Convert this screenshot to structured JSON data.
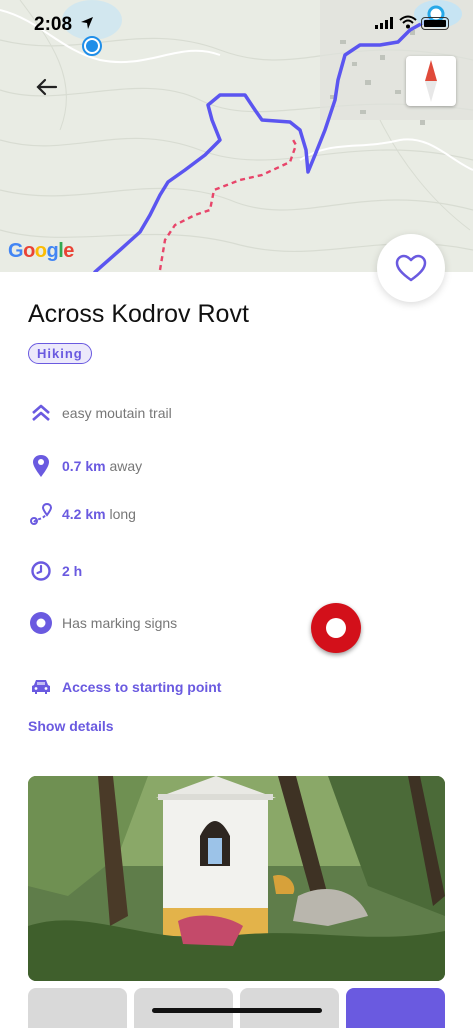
{
  "status": {
    "time": "2:08"
  },
  "map": {
    "provider": "Google"
  },
  "trail": {
    "title": "Across Kodrov Rovt",
    "tag": "Hiking",
    "difficulty": "easy moutain trail",
    "distance_value": "0.7 km",
    "distance_suffix": "away",
    "length_value": "4.2 km",
    "length_suffix": "long",
    "duration": "2 h",
    "marking": "Has marking signs",
    "access_label": "Access to starting point",
    "show_details": "Show details"
  },
  "colors": {
    "accent": "#6a5ae0",
    "record": "#d3101a"
  }
}
